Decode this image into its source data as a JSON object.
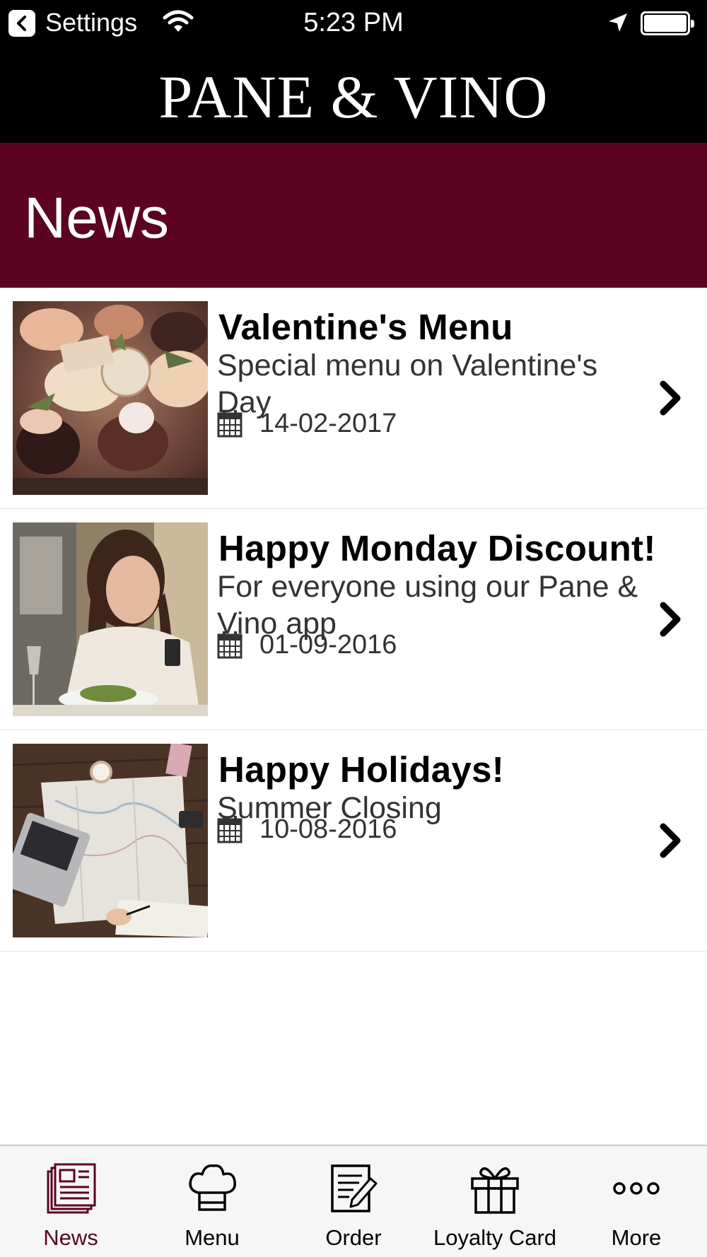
{
  "status_bar": {
    "back_label": "Settings",
    "time": "5:23 PM"
  },
  "brand": {
    "logo_text": "PANE & VINO"
  },
  "page": {
    "title": "News"
  },
  "news": [
    {
      "title": "Valentine's Menu",
      "description": "Special menu on Valentine's Day",
      "date": "14-02-2017"
    },
    {
      "title": "Happy Monday Discount!",
      "description": "For everyone using our Pane & Vino app",
      "date": "01-09-2016"
    },
    {
      "title": "Happy Holidays!",
      "description": "Summer Closing",
      "date": "10-08-2016"
    }
  ],
  "tabs": [
    {
      "label": "News",
      "icon": "newspaper-icon",
      "active": true
    },
    {
      "label": "Menu",
      "icon": "chef-hat-icon",
      "active": false
    },
    {
      "label": "Order",
      "icon": "order-form-icon",
      "active": false
    },
    {
      "label": "Loyalty Card",
      "icon": "gift-icon",
      "active": false
    },
    {
      "label": "More",
      "icon": "more-dots-icon",
      "active": false
    }
  ],
  "colors": {
    "brand_header": "#000000",
    "page_header": "#5c0322",
    "active_tab": "#5c0322"
  }
}
